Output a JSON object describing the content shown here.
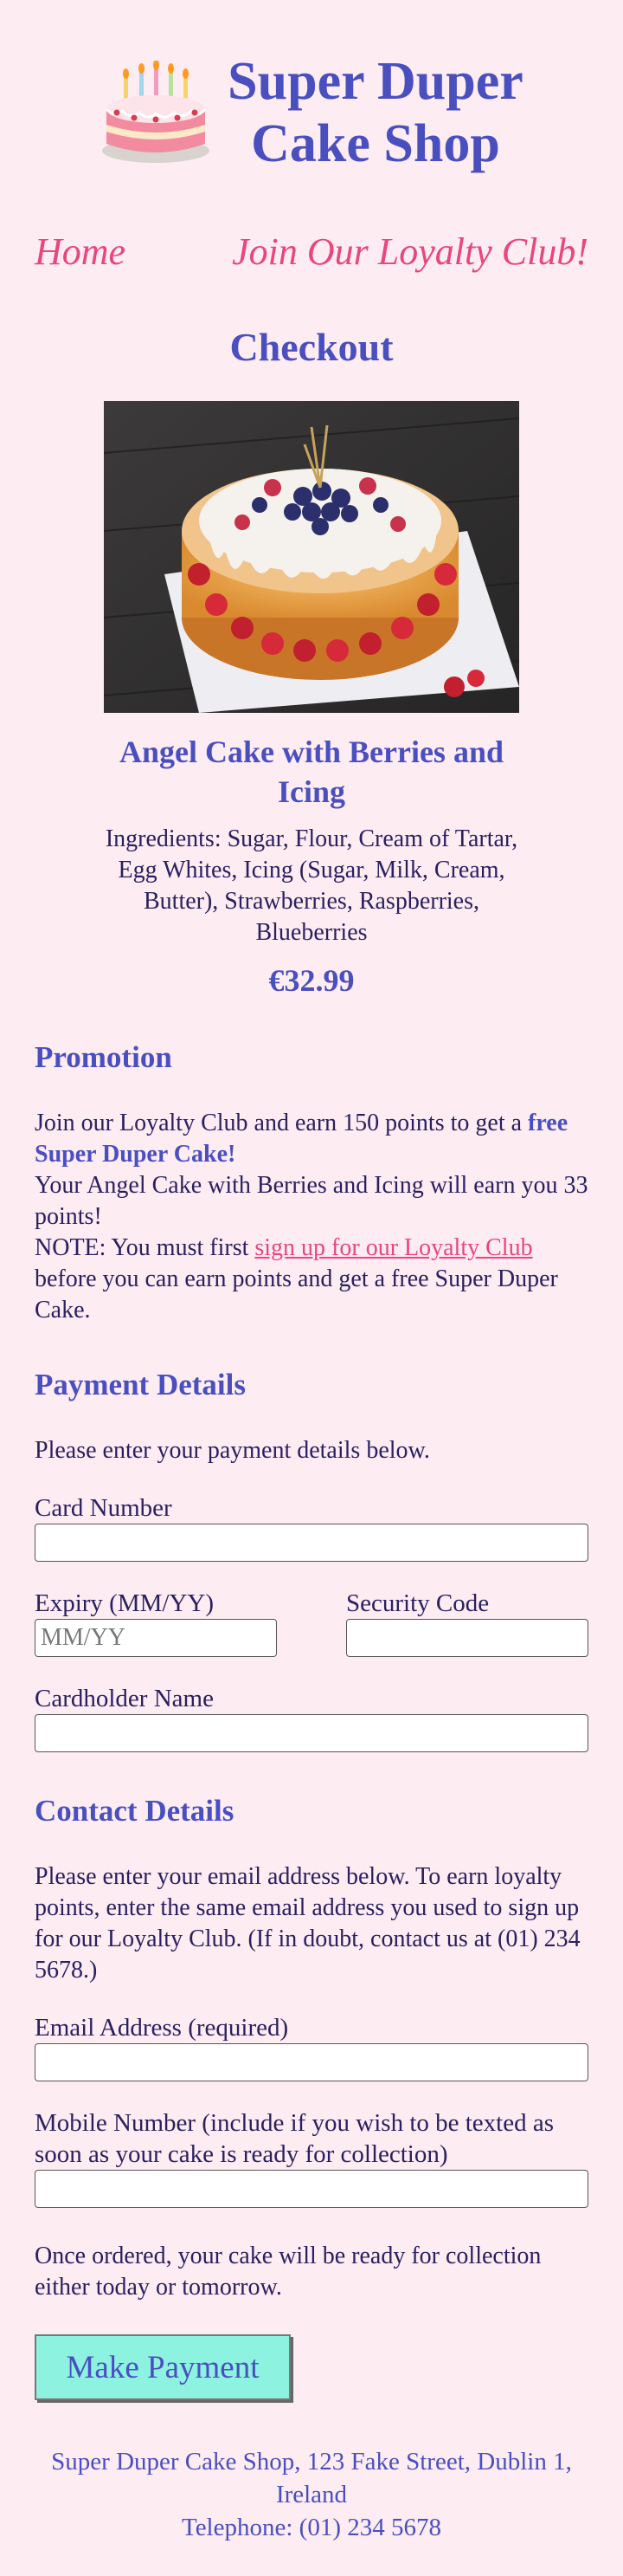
{
  "header": {
    "title_line1": "Super Duper",
    "title_line2": "Cake Shop",
    "logo_icon": "birthday-cake-icon"
  },
  "nav": {
    "home": "Home",
    "loyalty": "Join Our Loyalty Club!"
  },
  "page_title": "Checkout",
  "product": {
    "image_icon": "cake-photo",
    "name": "Angel Cake with Berries and Icing",
    "ingredients": "Ingredients: Sugar, Flour, Cream of Tartar, Egg Whites, Icing (Sugar, Milk, Cream, Butter), Strawberries, Raspberries, Blueberries",
    "price": "€32.99"
  },
  "promotion": {
    "heading": "Promotion",
    "line1_a": "Join our Loyalty Club and earn 150 points to get a ",
    "line1_b": "free Super Duper Cake!",
    "line2": "Your Angel Cake with Berries and Icing will earn you 33 points!",
    "note_a": "NOTE: You must first ",
    "note_link": "sign up for our Loyalty Club",
    "note_b": " before you can earn points and get a free Super Duper Cake."
  },
  "payment": {
    "heading": "Payment Details",
    "intro": "Please enter your payment details below.",
    "card_label": "Card Number",
    "card_value": "",
    "expiry_label": "Expiry (MM/YY)",
    "expiry_placeholder": "MM/YY",
    "security_label": "Security Code",
    "security_value": "",
    "name_label": "Cardholder Name",
    "name_value": ""
  },
  "contact": {
    "heading": "Contact Details",
    "intro": "Please enter your email address below. To earn loyalty points, enter the same email address you used to sign up for our Loyalty Club. (If in doubt, contact us at (01) 234 5678.)",
    "email_label": "Email Address (required)",
    "email_value": "",
    "mobile_label": "Mobile Number (include if you wish to be texted as soon as your cake is ready for collection)",
    "mobile_value": "",
    "ready_note": "Once ordered, your cake will be ready for collection either today or tomorrow."
  },
  "actions": {
    "pay_label": "Make Payment"
  },
  "footer": {
    "address": "Super Duper Cake Shop, 123 Fake Street, Dublin 1, Ireland",
    "telephone": "Telephone: (01) 234 5678"
  },
  "colors": {
    "background": "#fdecf2",
    "heading": "#4a4fc0",
    "accent": "#e8467c",
    "button": "#8df2df"
  }
}
